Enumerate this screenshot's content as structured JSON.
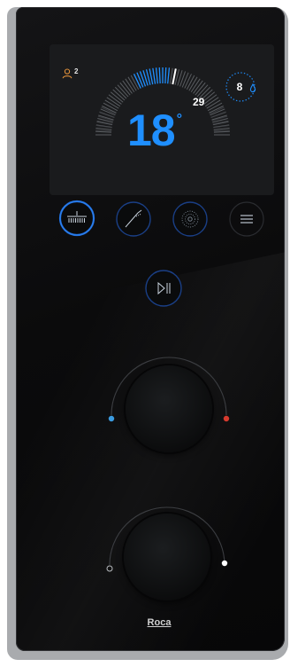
{
  "display": {
    "user_count": "2",
    "max_temperature": "29",
    "temperature": "18",
    "temperature_unit": "°",
    "flow_level": "8",
    "gauge_level_percent": 30
  },
  "mode_buttons": [
    {
      "name": "overhead-shower",
      "active": true
    },
    {
      "name": "hand-shower",
      "active": false
    },
    {
      "name": "rain-spray",
      "active": false
    },
    {
      "name": "menu",
      "active": false
    }
  ],
  "play_pause": {
    "label": "▷||"
  },
  "knobs": {
    "temperature": {
      "cold_color": "#3b9be0",
      "hot_color": "#d63a2e"
    },
    "flow": {
      "off_marker": "open",
      "on_marker": "filled"
    }
  },
  "brand": "Roca",
  "colors": {
    "accent_blue": "#1f8fff",
    "user_icon": "#e0903a"
  }
}
